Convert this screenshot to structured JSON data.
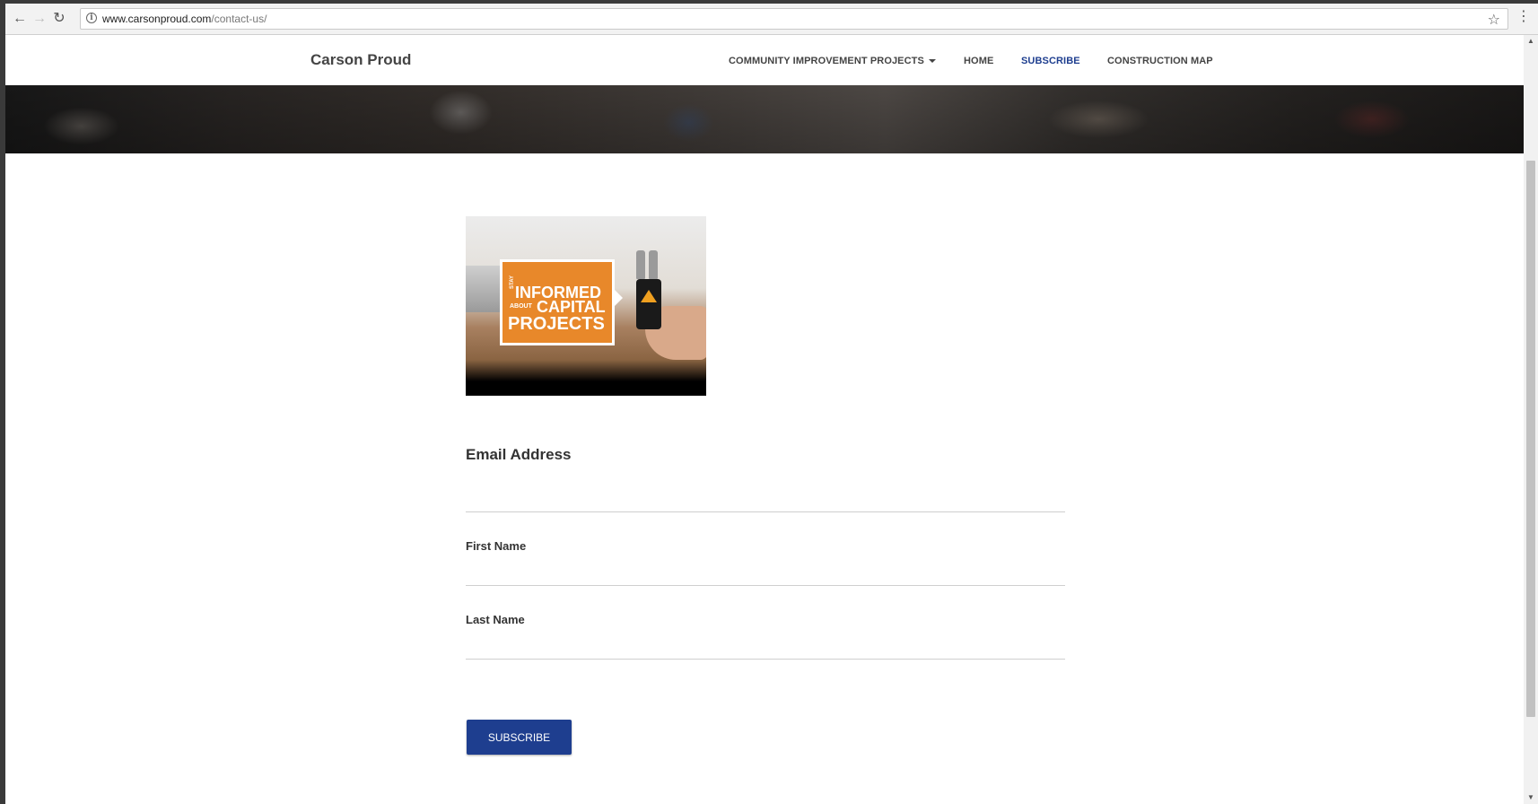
{
  "browser": {
    "url_host": "www.carsonproud.com",
    "url_path": "/contact-us/",
    "icons": {
      "back": "arrow-left-icon",
      "forward": "arrow-right-icon",
      "reload": "reload-icon",
      "info": "info-icon",
      "bookmark": "star-icon",
      "menu": "kebab-menu-icon"
    }
  },
  "site": {
    "brand": "Carson Proud",
    "nav": [
      {
        "label": "COMMUNITY IMPROVEMENT PROJECTS",
        "has_dropdown": true,
        "active": false
      },
      {
        "label": "HOME",
        "active": false
      },
      {
        "label": "SUBSCRIBE",
        "active": true
      },
      {
        "label": "CONSTRUCTION MAP",
        "active": false
      }
    ],
    "active_color": "#1e3e8f"
  },
  "promo": {
    "line0": "STAY",
    "line1": "INFORMED",
    "line2_small": "ABOUT",
    "line2": "CAPITAL",
    "line3": "PROJECTS",
    "accent_color": "#e8882a"
  },
  "form": {
    "email_label": "Email Address",
    "email_value": "",
    "first_name_label": "First Name",
    "first_name_value": "",
    "last_name_label": "Last Name",
    "last_name_value": "",
    "submit_label": "SUBSCRIBE",
    "button_color": "#1e3e8f"
  }
}
